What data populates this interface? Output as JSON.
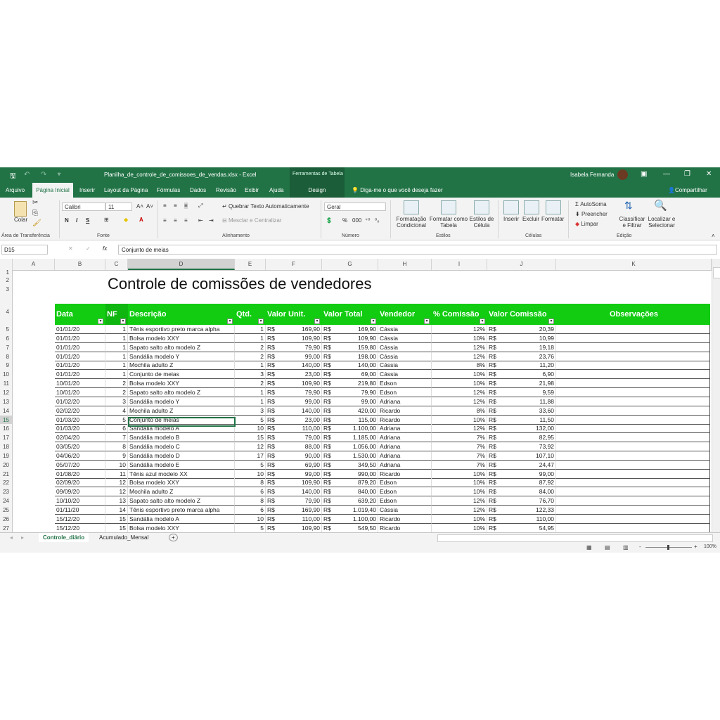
{
  "titlebar": {
    "doc": "Planilha_de_controle_de_comissoes_de_vendas.xlsx  -  Excel",
    "tools": "Ferramentas de Tabela",
    "user": "Isabela Fernanda"
  },
  "tabs": {
    "arquivo": "Arquivo",
    "pagina": "Página Inicial",
    "inserir": "Inserir",
    "layout": "Layout da Página",
    "formulas": "Fórmulas",
    "dados": "Dados",
    "revisao": "Revisão",
    "exibir": "Exibir",
    "ajuda": "Ajuda",
    "design": "Design",
    "tell": "Diga-me o que você deseja fazer",
    "share": "Compartilhar"
  },
  "ribbon": {
    "colar": "Colar",
    "font_name": "Calibri",
    "font_size": "11",
    "n": "N",
    "i": "I",
    "s": "S",
    "quebrar": "Quebrar Texto Automaticamente",
    "mesclar": "Mesclar e Centralizar",
    "numfmt": "Geral",
    "cond1": "Formatação",
    "cond2": "Condicional",
    "tab1": "Formatar como",
    "tab2": "Tabela",
    "est1": "Estilos de",
    "est2": "Célula",
    "inserir": "Inserir",
    "excluir": "Excluir",
    "formatar": "Formatar",
    "autosoma": "AutoSoma",
    "preencher": "Preencher",
    "limpar": "Limpar",
    "class1": "Classificar",
    "class2": "e Filtrar",
    "loc1": "Localizar e",
    "loc2": "Selecionar",
    "g_area": "Área de Transferência",
    "g_fonte": "Fonte",
    "g_alin": "Alinhamento",
    "g_num": "Número",
    "g_est": "Estilos",
    "g_cel": "Células",
    "g_edi": "Edição"
  },
  "formula": {
    "name": "D15",
    "content": "Conjunto de meias",
    "x": "✕",
    "check": "✓",
    "fx": "fx"
  },
  "columns": [
    "A",
    "B",
    "C",
    "D",
    "E",
    "F",
    "G",
    "H",
    "I",
    "J",
    "K"
  ],
  "sheet_title": "Controle de comissões de vendedores",
  "headers": [
    "Data",
    "NF",
    "Descrição",
    "Qtd.",
    "Valor Unit.",
    "Valor Total",
    "Vendedor",
    "% Comissão",
    "Valor Comissão",
    "Observações"
  ],
  "rows": [
    [
      "5",
      "01/01/20",
      "1",
      "Tênis esportivo preto marca alpha",
      "1",
      "R$",
      "169,90",
      "R$",
      "169,90",
      "Cássia",
      "12%",
      "R$",
      "20,39"
    ],
    [
      "6",
      "01/01/20",
      "1",
      "Bolsa modelo XXY",
      "1",
      "R$",
      "109,90",
      "R$",
      "109,90",
      "Cássia",
      "10%",
      "R$",
      "10,99"
    ],
    [
      "7",
      "01/01/20",
      "1",
      "Sapato salto alto modelo Z",
      "2",
      "R$",
      "79,90",
      "R$",
      "159,80",
      "Cássia",
      "12%",
      "R$",
      "19,18"
    ],
    [
      "8",
      "01/01/20",
      "1",
      "Sandália modelo Y",
      "2",
      "R$",
      "99,00",
      "R$",
      "198,00",
      "Cássia",
      "12%",
      "R$",
      "23,76"
    ],
    [
      "9",
      "01/01/20",
      "1",
      "Mochila adulto Z",
      "1",
      "R$",
      "140,00",
      "R$",
      "140,00",
      "Cássia",
      "8%",
      "R$",
      "11,20"
    ],
    [
      "10",
      "01/01/20",
      "1",
      "Conjunto de meias",
      "3",
      "R$",
      "23,00",
      "R$",
      "69,00",
      "Cássia",
      "10%",
      "R$",
      "6,90"
    ],
    [
      "11",
      "10/01/20",
      "2",
      "Bolsa modelo XXY",
      "2",
      "R$",
      "109,90",
      "R$",
      "219,80",
      "Edson",
      "10%",
      "R$",
      "21,98"
    ],
    [
      "12",
      "10/01/20",
      "2",
      "Sapato salto alto modelo Z",
      "1",
      "R$",
      "79,90",
      "R$",
      "79,90",
      "Edson",
      "12%",
      "R$",
      "9,59"
    ],
    [
      "13",
      "01/02/20",
      "3",
      "Sandália modelo Y",
      "1",
      "R$",
      "99,00",
      "R$",
      "99,00",
      "Adriana",
      "12%",
      "R$",
      "11,88"
    ],
    [
      "14",
      "02/02/20",
      "4",
      "Mochila adulto Z",
      "3",
      "R$",
      "140,00",
      "R$",
      "420,00",
      "Ricardo",
      "8%",
      "R$",
      "33,60"
    ],
    [
      "15",
      "01/03/20",
      "5",
      "Conjunto de meias",
      "5",
      "R$",
      "23,00",
      "R$",
      "115,00",
      "Ricardo",
      "10%",
      "R$",
      "11,50"
    ],
    [
      "16",
      "01/03/20",
      "6",
      "Sandália modelo A",
      "10",
      "R$",
      "110,00",
      "R$",
      "1.100,00",
      "Adriana",
      "12%",
      "R$",
      "132,00"
    ],
    [
      "17",
      "02/04/20",
      "7",
      "Sandália modelo B",
      "15",
      "R$",
      "79,00",
      "R$",
      "1.185,00",
      "Adriana",
      "7%",
      "R$",
      "82,95"
    ],
    [
      "18",
      "03/05/20",
      "8",
      "Sandália modelo C",
      "12",
      "R$",
      "88,00",
      "R$",
      "1.056,00",
      "Adriana",
      "7%",
      "R$",
      "73,92"
    ],
    [
      "19",
      "04/06/20",
      "9",
      "Sandália modelo D",
      "17",
      "R$",
      "90,00",
      "R$",
      "1.530,00",
      "Adriana",
      "7%",
      "R$",
      "107,10"
    ],
    [
      "20",
      "05/07/20",
      "10",
      "Sandália modelo E",
      "5",
      "R$",
      "69,90",
      "R$",
      "349,50",
      "Adriana",
      "7%",
      "R$",
      "24,47"
    ],
    [
      "21",
      "01/08/20",
      "11",
      "Tênis azul modelo XX",
      "10",
      "R$",
      "99,00",
      "R$",
      "990,00",
      "Ricardo",
      "10%",
      "R$",
      "99,00"
    ],
    [
      "22",
      "02/09/20",
      "12",
      "Bolsa modelo XXY",
      "8",
      "R$",
      "109,90",
      "R$",
      "879,20",
      "Edson",
      "10%",
      "R$",
      "87,92"
    ],
    [
      "23",
      "09/09/20",
      "12",
      "Mochila adulto Z",
      "6",
      "R$",
      "140,00",
      "R$",
      "840,00",
      "Edson",
      "10%",
      "R$",
      "84,00"
    ],
    [
      "24",
      "10/10/20",
      "13",
      "Sapato salto alto modelo Z",
      "8",
      "R$",
      "79,90",
      "R$",
      "639,20",
      "Edson",
      "12%",
      "R$",
      "76,70"
    ],
    [
      "25",
      "01/11/20",
      "14",
      "Tênis esportivo preto marca alpha",
      "6",
      "R$",
      "169,90",
      "R$",
      "1.019,40",
      "Cássia",
      "12%",
      "R$",
      "122,33"
    ],
    [
      "26",
      "15/12/20",
      "15",
      "Sandália modelo A",
      "10",
      "R$",
      "110,00",
      "R$",
      "1.100,00",
      "Ricardo",
      "10%",
      "R$",
      "110,00"
    ],
    [
      "27",
      "15/12/20",
      "15",
      "Bolsa modelo XXY",
      "5",
      "R$",
      "109,90",
      "R$",
      "549,50",
      "Ricardo",
      "10%",
      "R$",
      "54,95"
    ]
  ],
  "row_numbers_top": [
    "1",
    "2",
    "3",
    "4"
  ],
  "sheets": {
    "active": "Controle_diário",
    "other": "Acumulado_Mensal",
    "add": "+"
  },
  "status": {
    "zoom": "100%",
    "minus": "-",
    "plus": "+"
  }
}
